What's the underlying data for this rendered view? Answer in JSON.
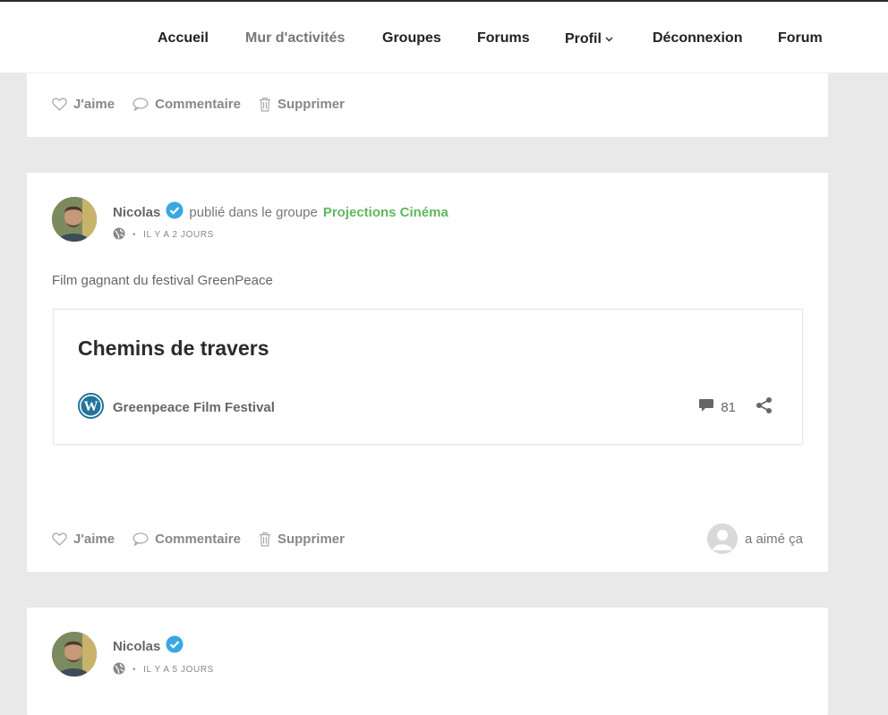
{
  "nav": {
    "items": [
      "Accueil",
      "Mur d'activités",
      "Groupes",
      "Forums",
      "Profil",
      "Déconnexion",
      "Forum"
    ]
  },
  "actions": {
    "like": "J'aime",
    "comment": "Commentaire",
    "delete": "Supprimer"
  },
  "post1": {
    "author": "Nicolas",
    "published_in": "publié dans le groupe",
    "group": "Projections Cinéma",
    "time": "IL Y A 2 JOURS",
    "separator": "•",
    "text": "Film gagnant du festival GreenPeace",
    "embed": {
      "title": "Chemins de travers",
      "site": "Greenpeace Film Festival",
      "comment_count": "81"
    },
    "liked_text": "a aimé ça"
  },
  "post2": {
    "author": "Nicolas",
    "time": "IL Y A 5 JOURS",
    "separator": "•"
  },
  "colors": {
    "accent_group": "#5fb85f",
    "verified": "#3aa7e0",
    "wordpress": "#21759b",
    "background": "#e9e9e9"
  },
  "icons": [
    "heart-icon",
    "comment-icon",
    "trash-icon",
    "verified-icon",
    "globe-icon",
    "wordpress-icon",
    "speech-bubble-icon",
    "share-icon",
    "chevron-down-icon"
  ]
}
